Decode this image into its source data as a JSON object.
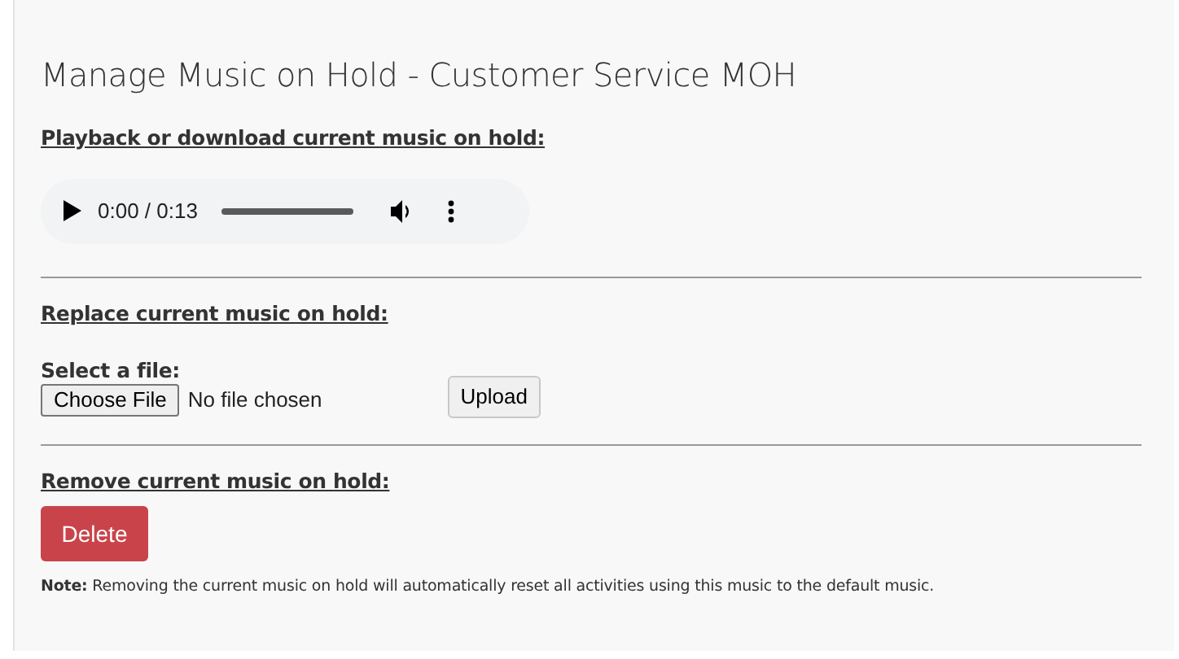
{
  "title": "Manage Music on Hold - Customer Service MOH",
  "playback": {
    "heading": "Playback or download current music on hold:",
    "player": {
      "time": "0:00 / 0:13"
    }
  },
  "replace": {
    "heading": "Replace current music on hold:",
    "file_label": "Select a file:",
    "choose_button": "Choose File",
    "file_status": "No file chosen",
    "upload_button": "Upload"
  },
  "remove": {
    "heading": "Remove current music on hold:",
    "delete_button": "Delete",
    "note": "**Note:** Removing the current music on hold will automatically reset all activities using this music to the default music."
  }
}
